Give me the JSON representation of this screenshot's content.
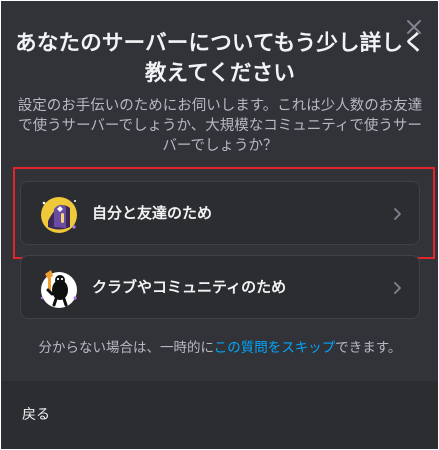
{
  "modal": {
    "title": "あなたのサーバーについてもう少し詳しく教えてください",
    "subtitle": "設定のお手伝いのためにお伺いします。これは少人数のお友達で使うサーバーでしょうか、大規模なコミュニティで使うサーバーでしょうか？",
    "close_icon": "close-icon"
  },
  "options": [
    {
      "label": "自分と友達のため",
      "icon": "friends-illustration-icon",
      "chevron": "chevron-right-icon",
      "highlighted": true
    },
    {
      "label": "クラブやコミュニティのため",
      "icon": "community-illustration-icon",
      "chevron": "chevron-right-icon",
      "highlighted": false
    }
  ],
  "skip": {
    "prefix": "分からない場合は、一時的に",
    "link": "この質問をスキップ",
    "suffix": "できます。"
  },
  "footer": {
    "back_label": "戻る"
  },
  "colors": {
    "modal_bg": "#313338",
    "option_bg": "#2b2d31",
    "footer_bg": "#2b2d31",
    "link": "#00a8fc",
    "highlight_border": "#e0262d"
  }
}
